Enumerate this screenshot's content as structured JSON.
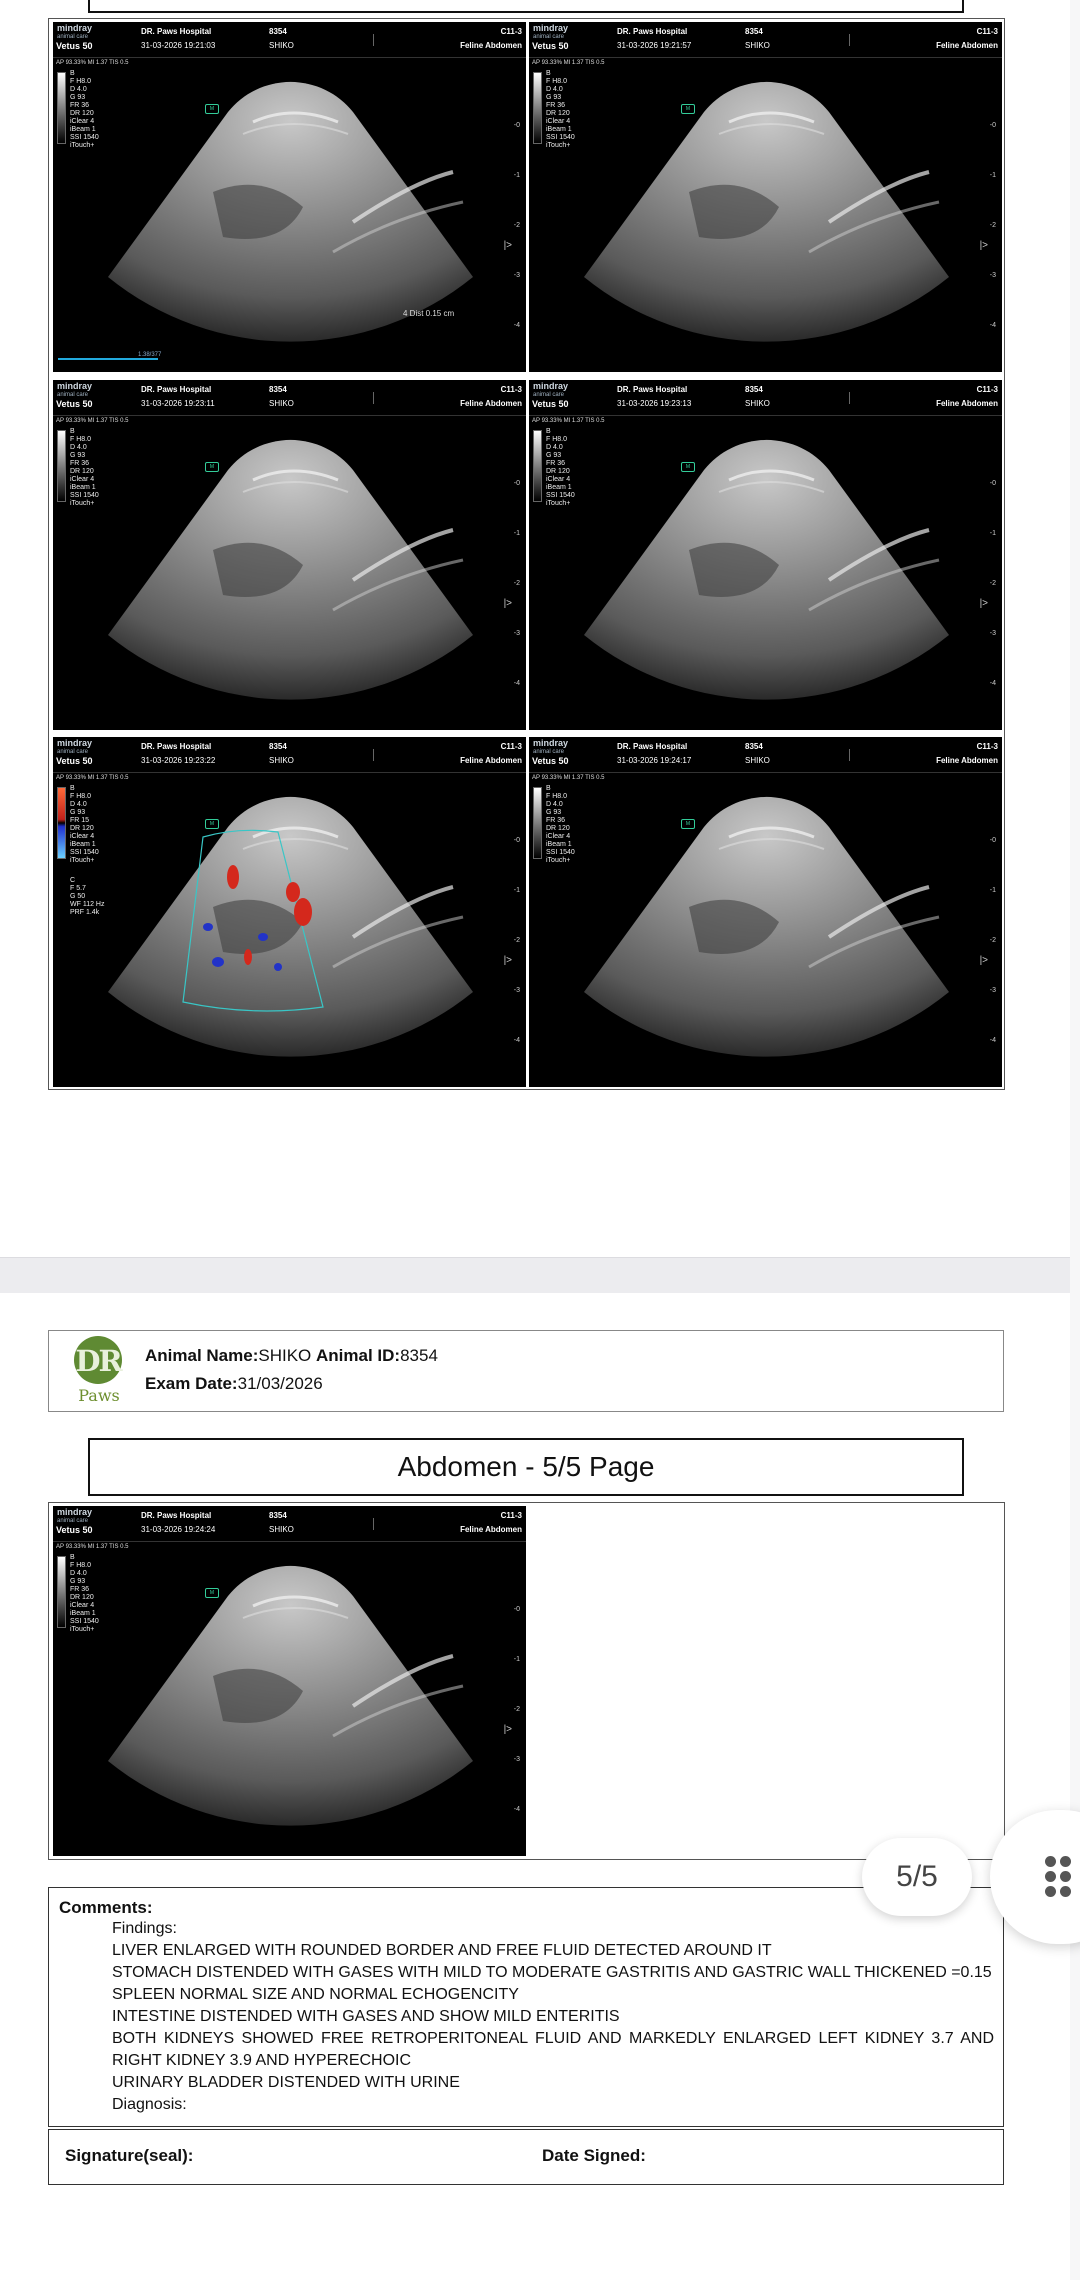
{
  "report": {
    "animal_name_label": "Animal Name:",
    "animal_name": "SHIKO",
    "animal_id_label": "Animal ID:",
    "animal_id": "8354",
    "exam_date_label": "Exam Date:",
    "exam_date": "31/03/2026",
    "logo_top": "DR",
    "logo_bottom": "Paws",
    "page_title": "Abdomen  -  5/5 Page"
  },
  "scan_common": {
    "brand": "mindray",
    "brand_sub": "animal care",
    "model": "Vetus 50",
    "hospital": "DR. Paws Hospital",
    "patient_id": "8354",
    "patient_name": "SHIKO",
    "probe": "C11-3",
    "preset": "Feline Abdomen",
    "ap_line": "AP 93.33%  MI 1.37  TIS 0.5",
    "depth_marks": [
      "0",
      "1",
      "2",
      "3",
      "4"
    ]
  },
  "scans": [
    {
      "time": "31-03-2026 19:21:03",
      "params": "B\nF H8.0\nD 4.0\nG 93\nFR 36\nDR 120\niClear 4\niBeam 1\nSSI 1540\niTouch+",
      "measure": "4  Dist    0.15 cm",
      "scale_text": "1.38/377"
    },
    {
      "time": "31-03-2026 19:21:57",
      "params": "B\nF H8.0\nD 4.0\nG 93\nFR 36\nDR 120\niClear 4\niBeam 1\nSSI 1540\niTouch+"
    },
    {
      "time": "31-03-2026 19:23:11",
      "params": "B\nF H8.0\nD 4.0\nG 93\nFR 36\nDR 120\niClear 4\niBeam 1\nSSI 1540\niTouch+"
    },
    {
      "time": "31-03-2026 19:23:13",
      "params": "B\nF H8.0\nD 4.0\nG 93\nFR 36\nDR 120\niClear 4\niBeam 1\nSSI 1540\niTouch+"
    },
    {
      "time": "31-03-2026 19:23:22",
      "params": "B\nF H8.0\nD 4.0\nG 93\nFR 15\nDR 120\niClear 4\niBeam 1\nSSI 1540\niTouch+",
      "color_params": "C\nF 5.7\nG 50\nWF 112 Hz\nPRF 1.4k"
    },
    {
      "time": "31-03-2026 19:24:17",
      "params": "B\nF H8.0\nD 4.0\nG 93\nFR 36\nDR 120\niClear 4\niBeam 1\nSSI 1540\niTouch+"
    },
    {
      "time": "31-03-2026 19:24:24",
      "params": "B\nF H8.0\nD 4.0\nG 93\nFR 36\nDR 120\niClear 4\niBeam 1\nSSI 1540\niTouch+"
    }
  ],
  "comments": {
    "title": "Comments:",
    "findings_label": "Findings:",
    "lines": [
      "LIVER ENLARGED WITH ROUNDED BORDER AND FREE FLUID DETECTED AROUND IT",
      "STOMACH DISTENDED WITH GASES WITH MILD TO MODERATE GASTRITIS AND GASTRIC WALL THICKENED =0.15",
      "SPLEEN NORMAL SIZE AND NORMAL ECHOGENCITY",
      "INTESTINE DISTENDED WITH GASES AND SHOW MILD ENTERITIS",
      "BOTH KIDNEYS SHOWED FREE RETROPERITONEAL FLUID AND MARKEDLY ENLARGED LEFT KIDNEY 3.7 AND RIGHT KIDNEY 3.9 AND HYPERECHOIC",
      "URINARY BLADDER DISTENDED WITH URINE"
    ],
    "diagnosis_label": "Diagnosis:"
  },
  "signature": {
    "seal_label": "Signature(seal):",
    "date_label": "Date Signed:"
  },
  "viewer": {
    "page_counter": "5/5"
  },
  "colors": {
    "logo_green": "#5f8a33",
    "doppler_red": "#d4281c",
    "doppler_blue": "#2233c8",
    "roi_cyan": "#39c6c6"
  }
}
